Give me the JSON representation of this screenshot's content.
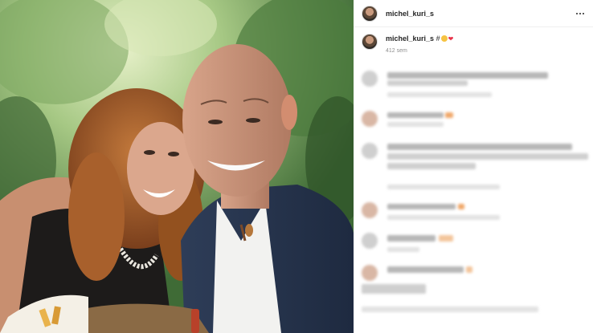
{
  "post": {
    "username": "michel_kuri_s",
    "caption_username": "michel_kuri_s",
    "caption_text": "#",
    "time_ago": "412 sem"
  },
  "icons": {
    "more": "more-horizontal-icon",
    "caption_emoji_1": "smiling-face-icon",
    "caption_emoji_2": "red-heart-icon"
  },
  "colors": {
    "heart": "#e8334a",
    "smile": "#f6c342",
    "muted_text": "#8e8e8e",
    "divider": "#efefef"
  },
  "image": {
    "description_alt": "photo"
  }
}
